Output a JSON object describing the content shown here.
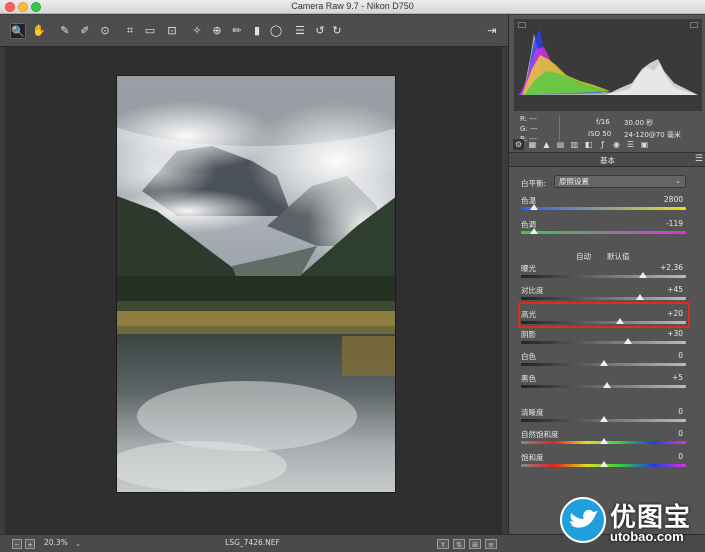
{
  "window": {
    "title": "Camera Raw 9.7 -  Nikon D750"
  },
  "toolbar": {
    "tools": [
      {
        "name": "zoom-tool",
        "glyph": "🔍"
      },
      {
        "name": "hand-tool",
        "glyph": "✋"
      },
      {
        "name": "white-balance-tool",
        "glyph": "✎"
      },
      {
        "name": "color-sampler-tool",
        "glyph": "✐"
      },
      {
        "name": "targeted-adjustment-tool",
        "glyph": "⊙"
      },
      {
        "name": "crop-tool",
        "glyph": "⌗"
      },
      {
        "name": "straighten-tool",
        "glyph": "▭"
      },
      {
        "name": "transform-tool",
        "glyph": "⊡"
      },
      {
        "name": "spot-removal-tool",
        "glyph": "✧"
      },
      {
        "name": "red-eye-tool",
        "glyph": "⊕"
      },
      {
        "name": "adjustment-brush-tool",
        "glyph": "✏"
      },
      {
        "name": "graduated-filter-tool",
        "glyph": "▮"
      },
      {
        "name": "radial-filter-tool",
        "glyph": "◯"
      },
      {
        "name": "preferences-tool",
        "glyph": "☰"
      },
      {
        "name": "rotate-left-tool",
        "glyph": "↺"
      },
      {
        "name": "rotate-right-tool",
        "glyph": "↻"
      },
      {
        "name": "fullscreen-toggle",
        "glyph": "⇥"
      }
    ]
  },
  "info": {
    "r": "R:  ---",
    "g": "G:  ---",
    "b": "B:  ---",
    "aperture": "f/16",
    "shutter": "30.00 秒",
    "iso": "ISO 50",
    "lens": "24-120@70 毫米"
  },
  "panel": {
    "section_title": "基本",
    "wb_label": "白平衡:",
    "wb_value": "原照设置",
    "auto_label": "自动",
    "default_label": "默认值"
  },
  "sliders": [
    {
      "key": "temp",
      "label": "色温",
      "value": "2800",
      "pos": 0.08,
      "gradient": "temp"
    },
    {
      "key": "tint",
      "label": "色调",
      "value": "-119",
      "pos": 0.08,
      "gradient": "tint"
    },
    {
      "key": "exposure",
      "label": "曝光",
      "value": "+2.36",
      "pos": 0.74,
      "gradient": "gray"
    },
    {
      "key": "contrast",
      "label": "对比度",
      "value": "+45",
      "pos": 0.72,
      "gradient": "gray"
    },
    {
      "key": "highlights",
      "label": "高光",
      "value": "+20",
      "pos": 0.6,
      "gradient": "gray"
    },
    {
      "key": "shadows",
      "label": "阴影",
      "value": "+30",
      "pos": 0.65,
      "gradient": "gray"
    },
    {
      "key": "whites",
      "label": "白色",
      "value": "0",
      "pos": 0.5,
      "gradient": "gray"
    },
    {
      "key": "blacks",
      "label": "黑色",
      "value": "+5",
      "pos": 0.52,
      "gradient": "gray"
    },
    {
      "key": "clarity",
      "label": "清晰度",
      "value": "0",
      "pos": 0.5,
      "gradient": "gray"
    },
    {
      "key": "vibrance",
      "label": "自然饱和度",
      "value": "0",
      "pos": 0.5,
      "gradient": "sat"
    },
    {
      "key": "saturation",
      "label": "饱和度",
      "value": "0",
      "pos": 0.5,
      "gradient": "sat"
    }
  ],
  "status": {
    "zoom": "20.3%",
    "filename": "LSG_7426.NEF"
  },
  "watermark": {
    "name": "优图宝",
    "url": "utobao.com"
  },
  "colors": {
    "highlight_box": "#e02b20",
    "histogram_blue": "#2a3cff",
    "histogram_yellow": "#e8e020",
    "histogram_magenta": "#e030e0",
    "histogram_green": "#30d040"
  }
}
